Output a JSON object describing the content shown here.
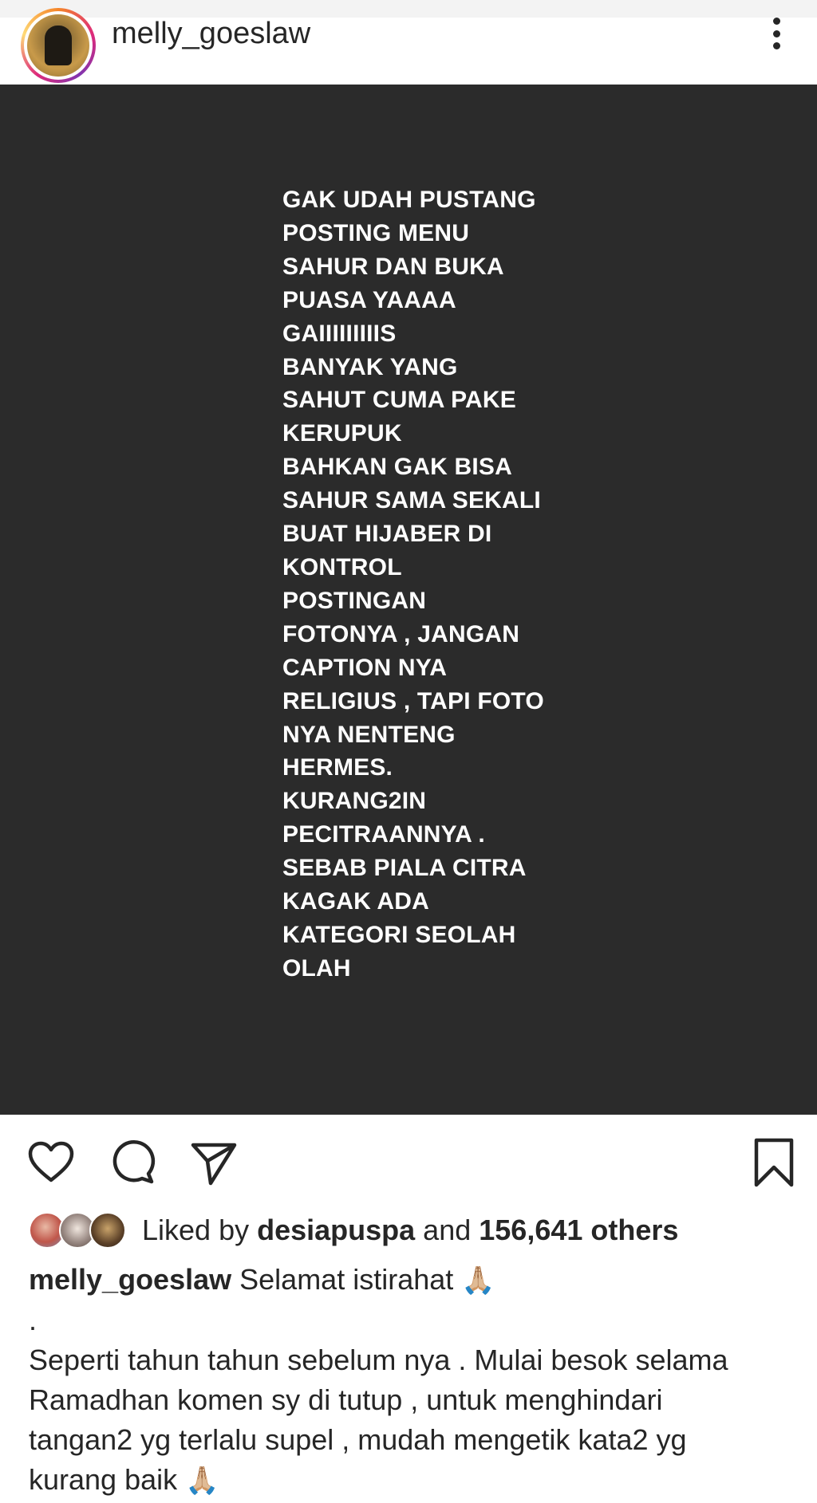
{
  "header": {
    "username": "melly_goeslaw",
    "avatar_icon": "profile-avatar",
    "more_icon": "more-vertical-icon"
  },
  "post": {
    "background": "#2b2b2b",
    "lines": [
      "GAK UDAH PUSTANG",
      "POSTING MENU",
      "SAHUR DAN BUKA",
      "PUASA YAAAA",
      "GAIIIIIIIIIS",
      "BANYAK YANG",
      "SAHUT CUMA PAKE",
      "KERUPUK",
      "BAHKAN GAK BISA",
      "SAHUR SAMA SEKALI",
      "BUAT HIJABER DI",
      "KONTROL",
      "POSTINGAN",
      "FOTONYA , JANGAN",
      "CAPTION NYA",
      "RELIGIUS , TAPI FOTO",
      "NYA NENTENG",
      "HERMES.",
      "KURANG2IN",
      "PECITRAANNYA .",
      "SEBAB PIALA CITRA",
      "KAGAK ADA",
      "KATEGORI SEOLAH",
      "OLAH"
    ]
  },
  "actions": {
    "like_icon": "heart-icon",
    "comment_icon": "comment-icon",
    "share_icon": "send-icon",
    "save_icon": "bookmark-icon"
  },
  "likes": {
    "prefix": "Liked by ",
    "user": "desiapuspa",
    "middle": " and ",
    "count": "156,641 others"
  },
  "caption": {
    "username": "melly_goeslaw",
    "first_line": " Selamat istirahat ",
    "dot": ".",
    "lines": [
      "Seperti tahun tahun sebelum nya . Mulai besok selama",
      "Ramadhan komen sy di tutup , untuk menghindari",
      "tangan2 yg terlalu supel , mudah mengetik kata2 yg"
    ],
    "last_line": "kurang baik ",
    "emoji": "🙏🏼"
  }
}
